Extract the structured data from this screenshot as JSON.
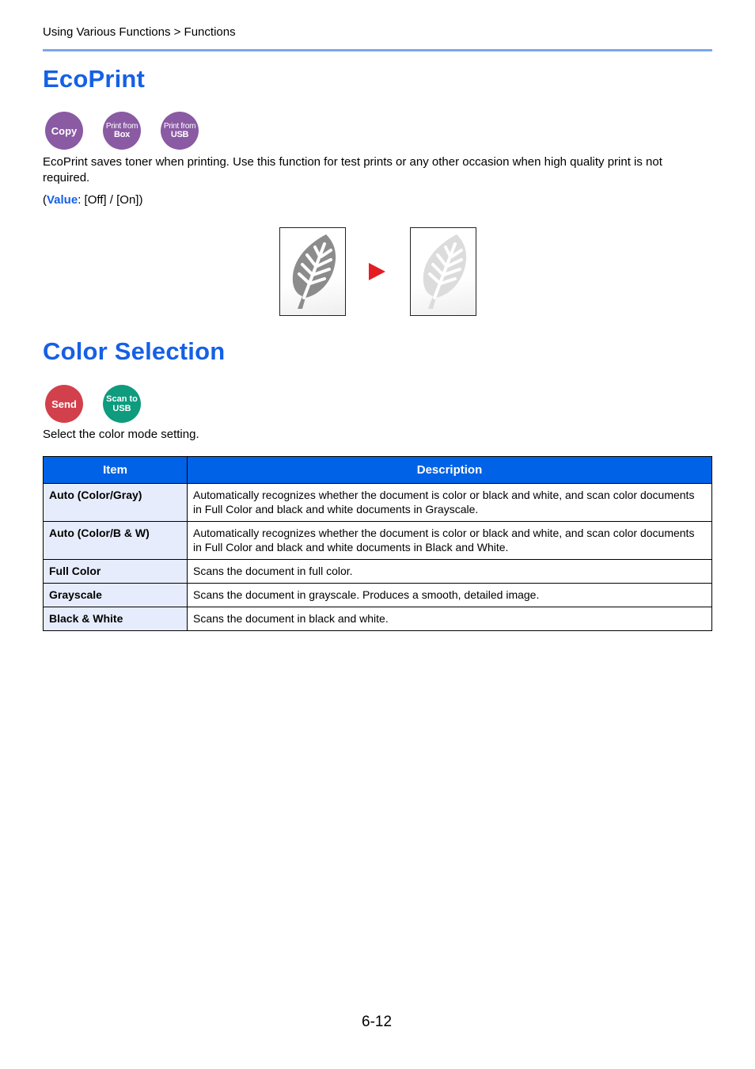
{
  "header": {
    "breadcrumb": "Using Various Functions > Functions"
  },
  "ecoprint": {
    "title": "EcoPrint",
    "badges": [
      {
        "line1": "Copy",
        "line2": "",
        "color": "#8a5aa3"
      },
      {
        "line1": "Print from",
        "line2": "Box",
        "color": "#8a5aa3"
      },
      {
        "line1": "Print from",
        "line2": "USB",
        "color": "#8a5aa3"
      }
    ],
    "description": "EcoPrint saves toner when printing. Use this function for test prints or any other occasion when high quality print is not required.",
    "value_open": "(",
    "value_label": "Value",
    "value_text": ": [Off] / [On])",
    "illustration": {
      "before": "leaf-normal-toner",
      "arrow": "arrow-right-icon",
      "after": "leaf-reduced-toner"
    }
  },
  "color_selection": {
    "title": "Color Selection",
    "badges": [
      {
        "line1": "Send",
        "line2": "",
        "color": "#d2404c"
      },
      {
        "line1": "Scan to",
        "line2": "USB",
        "color": "#0e9b7e"
      }
    ],
    "description": "Select the color mode setting.",
    "table": {
      "headers": [
        "Item",
        "Description"
      ],
      "rows": [
        {
          "item": "Auto (Color/Gray)",
          "description": "Automatically recognizes whether the document is color or black and white, and scan color documents in Full Color and black and white documents in Grayscale."
        },
        {
          "item": "Auto (Color/B & W)",
          "description": "Automatically recognizes whether the document is color or black and white, and scan color documents in Full Color and black and white documents in Black and White."
        },
        {
          "item": "Full Color",
          "description": "Scans the document in full color."
        },
        {
          "item": "Grayscale",
          "description": "Scans the document in grayscale. Produces a smooth, detailed image."
        },
        {
          "item": "Black & White",
          "description": "Scans the document in black and white."
        }
      ]
    }
  },
  "footer": {
    "page_number": "6-12"
  }
}
